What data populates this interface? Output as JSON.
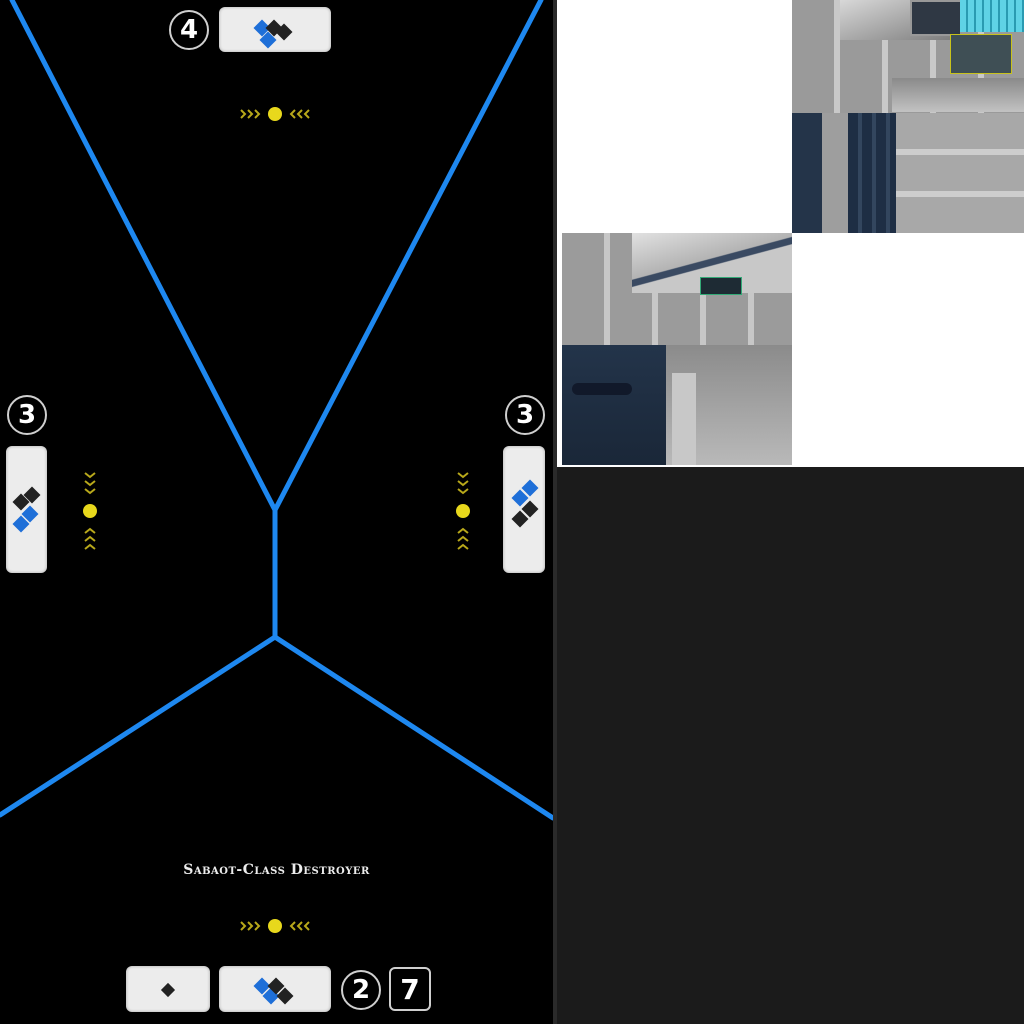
{
  "ship_card": {
    "ship_name": "Sabaot-Class Destroyer",
    "hull_value": "7",
    "speed_value": "2",
    "front_shield": "4",
    "left_shield": "3",
    "right_shield": "3",
    "line_color": "#1e88f0",
    "marker_color": "#e8d81c",
    "dice": {
      "front": [
        "blue",
        "black",
        "blue",
        "black"
      ],
      "left": [
        "black",
        "black",
        "blue",
        "blue"
      ],
      "right": [
        "blue",
        "blue",
        "black",
        "black"
      ],
      "rear": [
        "blue",
        "blue",
        "black",
        "black"
      ],
      "anti_squadron": [
        "black"
      ]
    }
  },
  "texture_sheet": {
    "panel_color": "#ffffff",
    "hull_gray": "#a9a9a9",
    "hull_navy": "#22344a"
  }
}
